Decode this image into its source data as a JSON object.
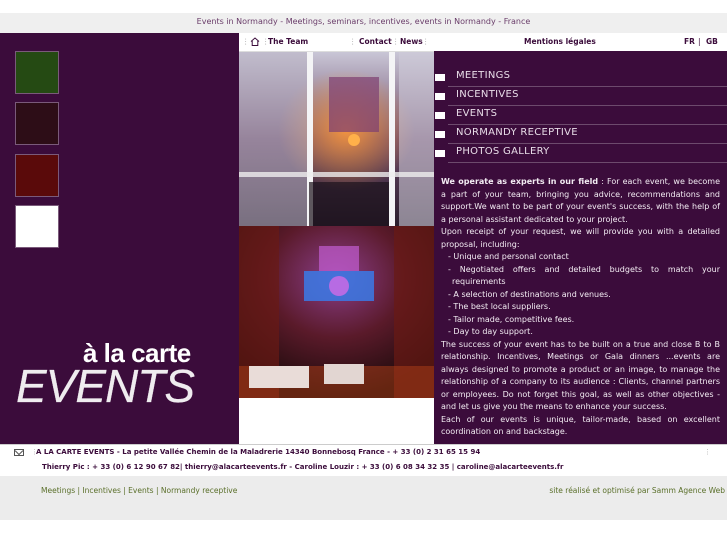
{
  "header": {
    "title": "Events in Normandy - Meetings, seminars, incentives, events in Normandy - France"
  },
  "nav": {
    "team": "The Team",
    "contact": "Contact",
    "news": "News",
    "legal": "Mentions légales",
    "lang_fr": "FR",
    "lang_sep": "|",
    "lang_gb": "GB"
  },
  "sidebar": {
    "swatches": [
      "#254a13",
      "#2d0d17",
      "#5a0a0a",
      "#ffffff"
    ],
    "logo_line1": "à la carte",
    "logo_line2": "EVENTS"
  },
  "menu": {
    "items": [
      {
        "label": "MEETINGS"
      },
      {
        "label": "INCENTIVES"
      },
      {
        "label": "EVENTS"
      },
      {
        "label": "NORMANDY RECEPTIVE"
      },
      {
        "label": "PHOTOS GALLERY"
      }
    ]
  },
  "content": {
    "intro_bold": "We operate as experts in our field",
    "intro_rest": " : For each event, we become a part of your team, bringing you advice, recommendations and support.We want to be part of your event's success, with the help of a personal assistant dedicated to your project.",
    "p2": "Upon receipt of your request, we will provide you with a detailed proposal, including:",
    "list": [
      "- Unique and personal contact",
      "- Negotiated offers and detailed budgets to match your requirements",
      "- A selection of destinations and venues.",
      "- The best local suppliers.",
      "- Tailor made, competitive fees.",
      "- Day to day support."
    ],
    "p3": "The success of your event has to be built on a true and close B to B relationship. Incentives, Meetings or Gala dinners ...events are always designed to promote a product or an image, to manage the relationship of a company to its audience : Clients, channel partners or employees. Do not forget this goal, as well as other objectives - and let us give you the means to enhance your success.",
    "p4": "Each of our events is unique, tailor-made, based on excellent coordination on and backstage."
  },
  "footer": {
    "line1": "A LA CARTE EVENTS - La petite Vallée Chemin de la Maladrerie 14340 Bonnebosq France - + 33 (0) 2 31 65 15 94",
    "line2": "Thierry Pic : + 33 (0) 6 12 90 67 82| thierry@alacarteevents.fr - Caroline Louzir : + 33 (0) 6 08 34 32 35 | caroline@alacarteevents.fr"
  },
  "bottom": {
    "links": "Meetings | Incentives | Events | Normandy receptive",
    "credit": "site réalisé et optimisé par Samm Agence Web"
  }
}
